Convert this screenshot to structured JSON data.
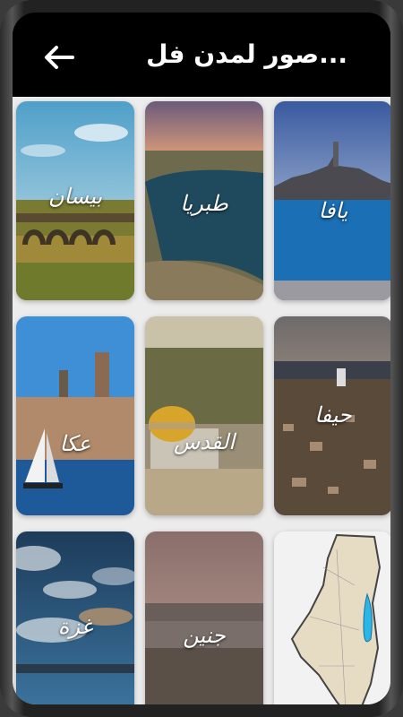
{
  "app": {
    "title": "...صور لمدن فل",
    "back_icon": "arrow-left-icon"
  },
  "colors": {
    "appbar_bg": "#000000",
    "grid_bg": "#ececec"
  },
  "tiles": [
    {
      "name": "بيسان"
    },
    {
      "name": "طبريا"
    },
    {
      "name": "يافا"
    },
    {
      "name": "عكا"
    },
    {
      "name": "القدس"
    },
    {
      "name": "حيفا"
    },
    {
      "name": "غزة"
    },
    {
      "name": "جنين"
    },
    {
      "name": "map-of-palestine"
    }
  ]
}
